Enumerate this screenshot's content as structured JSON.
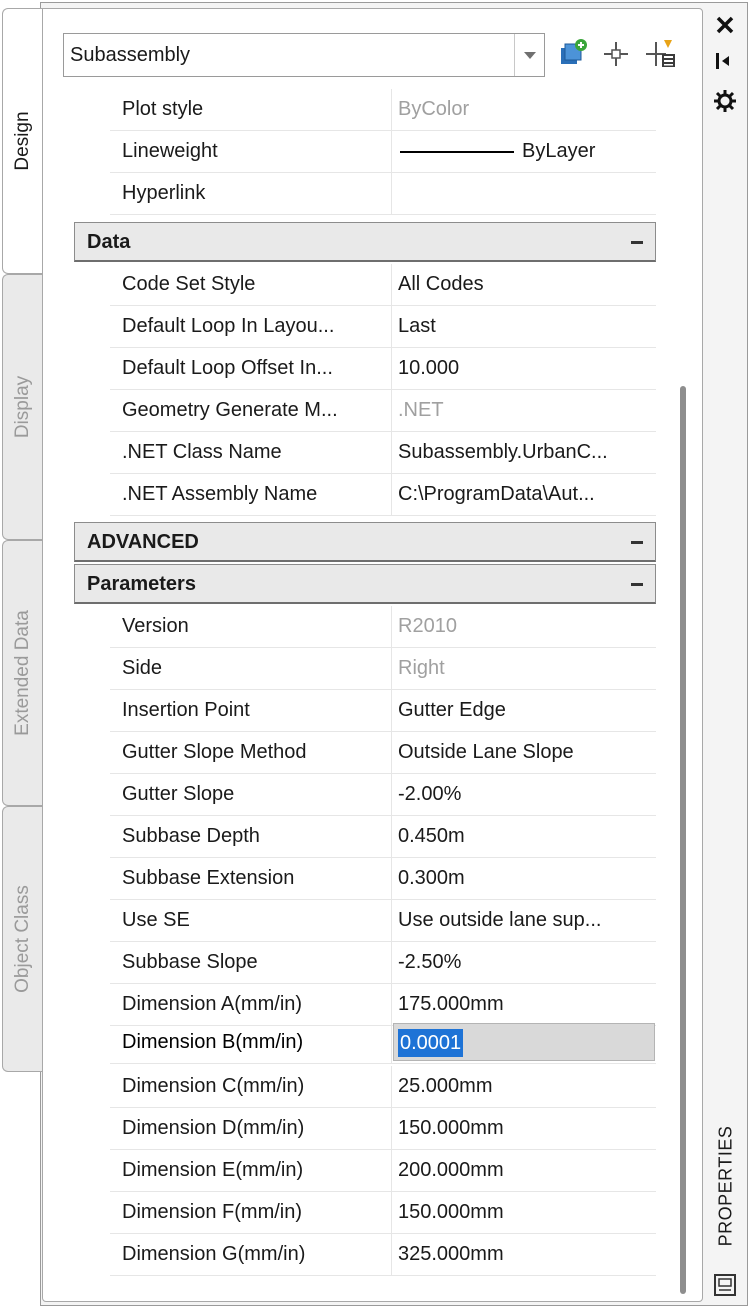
{
  "selector": {
    "value": "Subassembly"
  },
  "toolbar": {
    "add_icon": "add-object-icon",
    "pick_icon": "pick-crosshair-icon",
    "quick_select_icon": "quick-select-icon"
  },
  "side_tabs": [
    {
      "label": "Design",
      "active": true
    },
    {
      "label": "Display",
      "active": false
    },
    {
      "label": "Extended Data",
      "active": false
    },
    {
      "label": "Object Class",
      "active": false
    }
  ],
  "general_rows": [
    {
      "name": "Plot style",
      "value": "ByColor",
      "readonly": true
    },
    {
      "name": "Lineweight",
      "value": "ByLayer",
      "readonly": false
    },
    {
      "name": "Hyperlink",
      "value": "",
      "readonly": false
    }
  ],
  "data_section": {
    "title": "Data",
    "rows": [
      {
        "name": "Code Set Style",
        "value": "All Codes",
        "readonly": false
      },
      {
        "name": "Default Loop In Layou...",
        "value": "Last",
        "readonly": false
      },
      {
        "name": "Default Loop Offset In...",
        "value": "10.000",
        "readonly": false
      },
      {
        "name": "Geometry Generate M...",
        "value": ".NET",
        "readonly": true
      },
      {
        "name": ".NET Class Name",
        "value": "Subassembly.UrbanC...",
        "readonly": false
      },
      {
        "name": ".NET Assembly Name",
        "value": "C:\\ProgramData\\Aut...",
        "readonly": false
      }
    ]
  },
  "advanced_section": {
    "title": "ADVANCED"
  },
  "parameters_section": {
    "title": "Parameters",
    "rows": [
      {
        "name": "Version",
        "value": "R2010",
        "readonly": true
      },
      {
        "name": "Side",
        "value": "Right",
        "readonly": true
      },
      {
        "name": "Insertion Point",
        "value": "Gutter Edge",
        "readonly": false
      },
      {
        "name": "Gutter Slope Method",
        "value": "Outside Lane Slope",
        "readonly": false
      },
      {
        "name": "Gutter Slope",
        "value": "-2.00%",
        "readonly": false
      },
      {
        "name": "Subbase Depth",
        "value": "0.450m",
        "readonly": false
      },
      {
        "name": "Subbase Extension",
        "value": "0.300m",
        "readonly": false
      },
      {
        "name": "Use SE",
        "value": "Use outside lane sup...",
        "readonly": false
      },
      {
        "name": "Subbase Slope",
        "value": "-2.50%",
        "readonly": false
      },
      {
        "name": "Dimension A(mm/in)",
        "value": "175.000mm",
        "readonly": false
      },
      {
        "name": "Dimension B(mm/in)",
        "value": "0.0001",
        "readonly": false,
        "editing": true
      },
      {
        "name": "Dimension C(mm/in)",
        "value": "25.000mm",
        "readonly": false
      },
      {
        "name": "Dimension D(mm/in)",
        "value": "150.000mm",
        "readonly": false
      },
      {
        "name": "Dimension E(mm/in)",
        "value": "200.000mm",
        "readonly": false
      },
      {
        "name": "Dimension F(mm/in)",
        "value": "150.000mm",
        "readonly": false
      },
      {
        "name": "Dimension G(mm/in)",
        "value": "325.000mm",
        "readonly": false
      }
    ]
  },
  "palette": {
    "title": "PROPERTIES",
    "close_icon": "close-icon",
    "autohide_icon": "auto-hide-icon",
    "settings_icon": "settings-icon",
    "palette_icon": "properties-palette-icon"
  }
}
